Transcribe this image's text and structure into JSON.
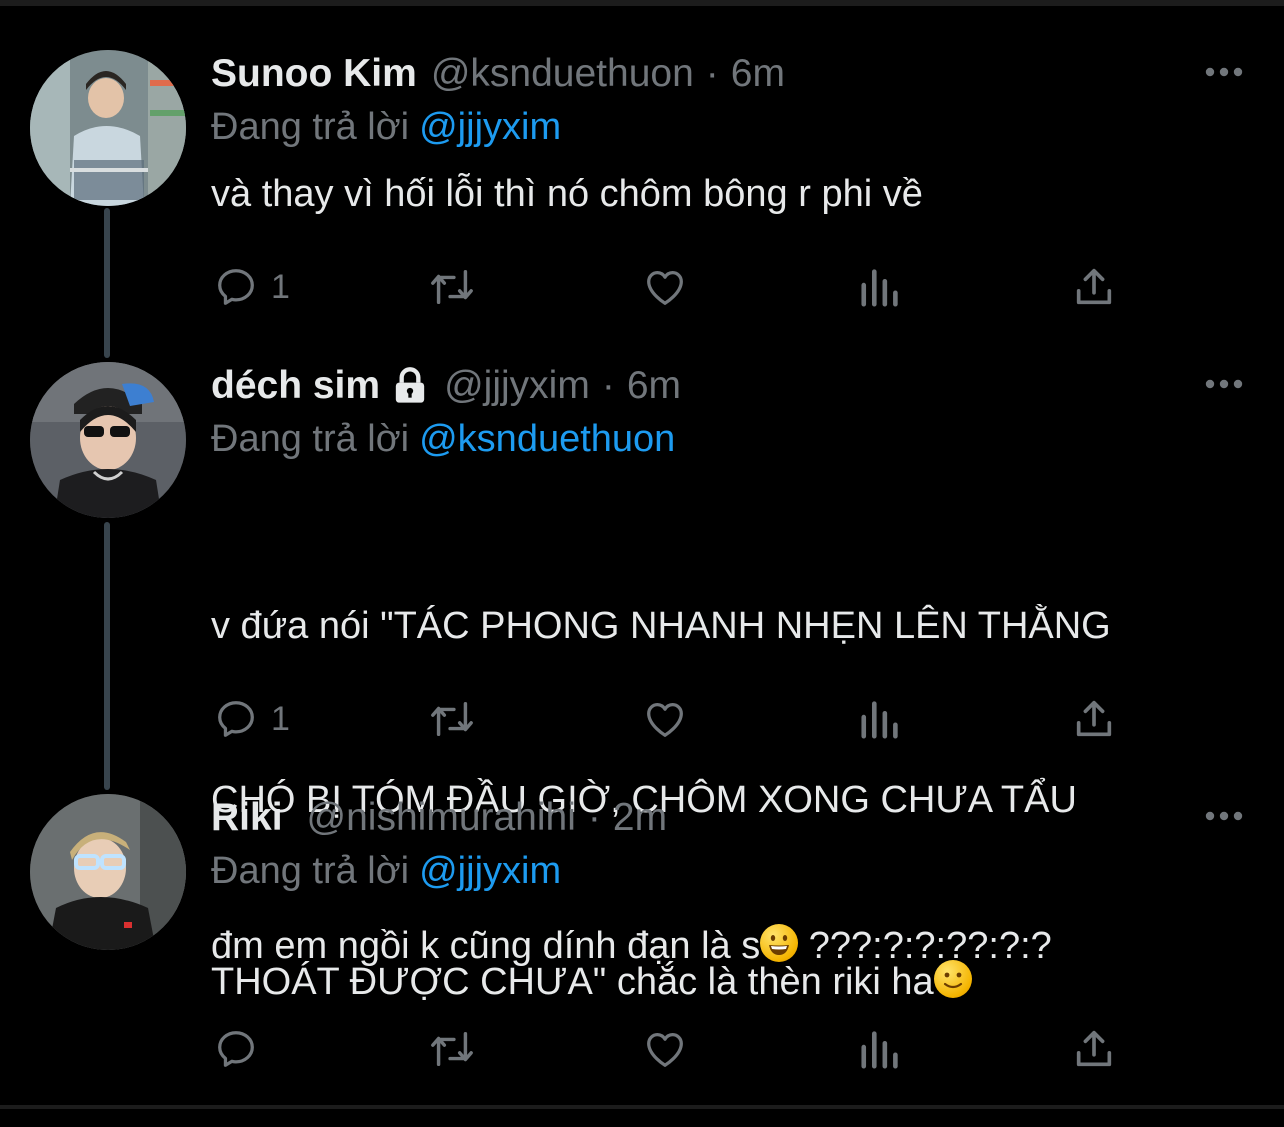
{
  "tweets": [
    {
      "name": "Sunoo Kim",
      "handle": "@ksnduethuon",
      "time": "6m",
      "replying_prefix": "Đang trả lời",
      "replying_to": "@jjjyxim",
      "text": "và thay vì hối lỗi thì nó chôm bông r phi về",
      "reply_count": "1",
      "locked": false,
      "avatar_colors": {
        "bg": "#8a9a9e",
        "shirt": "#c9d7df",
        "hair": "#2a2622"
      }
    },
    {
      "name": "déch sim",
      "handle": "@jjjyxim",
      "time": "6m",
      "replying_prefix": "Đang trả lời",
      "replying_to": "@ksnduethuon",
      "text_line1": "v đứa nói \"TÁC PHONG NHANH NHẸN LÊN THẰNG",
      "text_line2": "CHÓ BỊ TÓM ĐẦU GIỜ, CHÔM XONG CHƯA TẨU",
      "text_line3": "THOÁT ĐƯỢC CHƯA\" chắc là thèn riki ha",
      "emoji": "slightly-smiling-face",
      "reply_count": "1",
      "locked": true,
      "avatar_colors": {
        "bg": "#5c6066",
        "shirt": "#1d1d1f",
        "hair": "#222"
      }
    },
    {
      "name": "Riki",
      "handle": "@nishimurahihi",
      "time": "2m",
      "replying_prefix": "Đang trả lời",
      "replying_to": "@jjjyxim",
      "text_before": "đm em ngồi k cũng dính đạn là s",
      "emoji": "grinning-face",
      "text_after": " ???:?:?:??:?:?",
      "reply_count": "",
      "locked": false,
      "avatar_colors": {
        "bg": "#6a6f70",
        "shirt": "#1a1a1a",
        "hair": "#c8b07a"
      }
    }
  ],
  "colors": {
    "background": "#000000",
    "text": "#e7e9ea",
    "secondary": "#71767b",
    "link": "#1d9bf0",
    "thread_line": "#38444d"
  },
  "icons": [
    "reply-icon",
    "retweet-icon",
    "like-icon",
    "views-icon",
    "share-icon",
    "more-icon",
    "lock-icon"
  ]
}
